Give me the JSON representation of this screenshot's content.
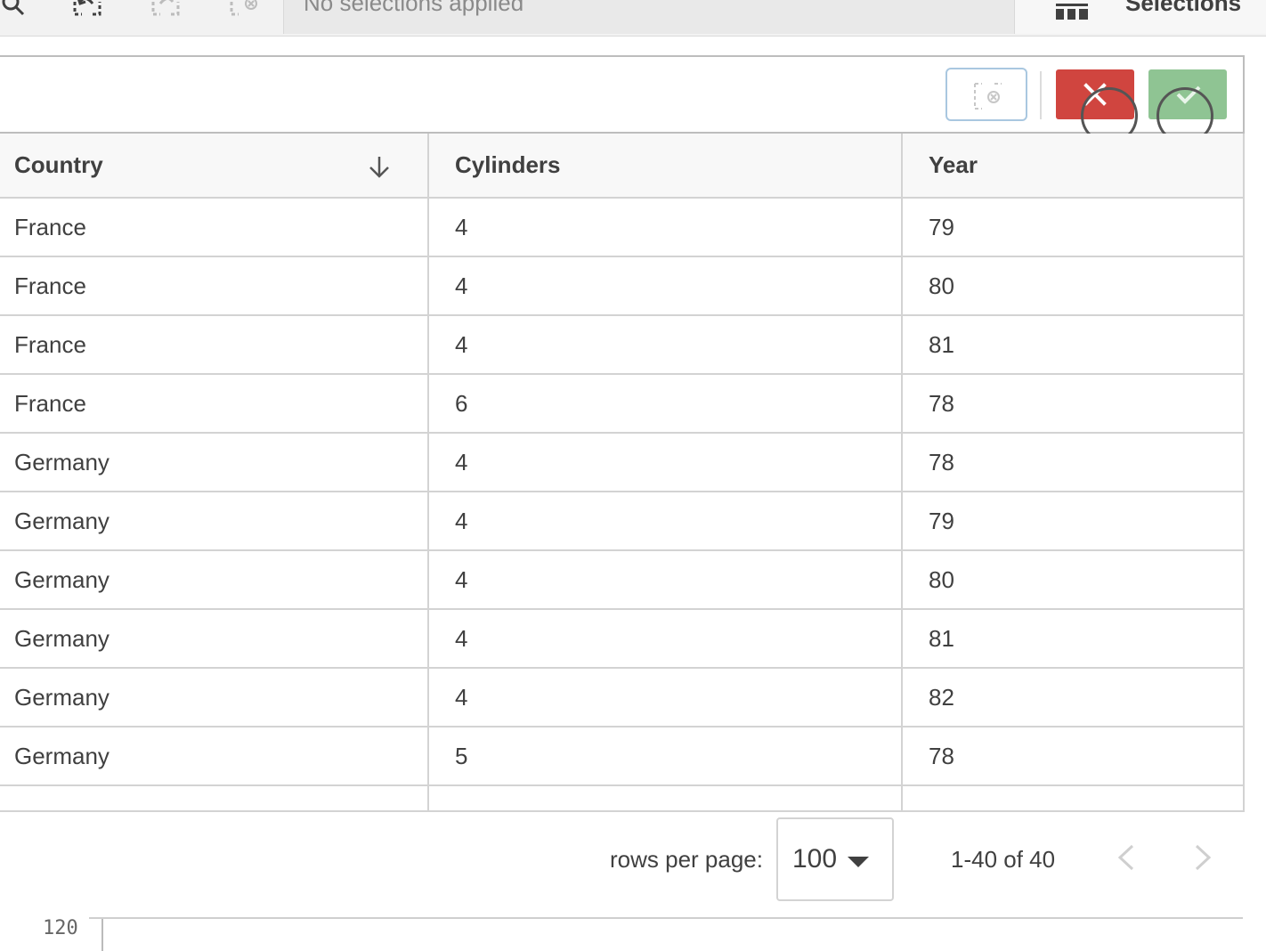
{
  "toolbar": {
    "selections_placeholder": "No selections applied",
    "selections_panel_label": "Selections",
    "icons": [
      "search-icon",
      "step-back-icon",
      "step-forward-icon",
      "clear-selections-icon",
      "grid-icon"
    ]
  },
  "selection_tool": {
    "icons": [
      "clear-selection-icon",
      "cancel-icon",
      "confirm-icon"
    ],
    "colors": {
      "cancel": "#d0453f",
      "confirm": "#8fc493",
      "clear_border": "#a9c7e0"
    }
  },
  "table": {
    "columns": [
      "Country",
      "Cylinders",
      "Year"
    ],
    "sort_icon": "arrow-down-icon",
    "rows": [
      [
        "France",
        "4",
        "79"
      ],
      [
        "France",
        "4",
        "80"
      ],
      [
        "France",
        "4",
        "81"
      ],
      [
        "France",
        "6",
        "78"
      ],
      [
        "Germany",
        "4",
        "78"
      ],
      [
        "Germany",
        "4",
        "79"
      ],
      [
        "Germany",
        "4",
        "80"
      ],
      [
        "Germany",
        "4",
        "81"
      ],
      [
        "Germany",
        "4",
        "82"
      ],
      [
        "Germany",
        "5",
        "78"
      ]
    ]
  },
  "pagination": {
    "rows_per_page_label": "rows per page:",
    "rows_per_page_value": "100",
    "range_text": "1-40 of 40",
    "prev_icon": "chevron-left-icon",
    "next_icon": "chevron-right-icon"
  },
  "axis": {
    "tick_label": "120"
  }
}
